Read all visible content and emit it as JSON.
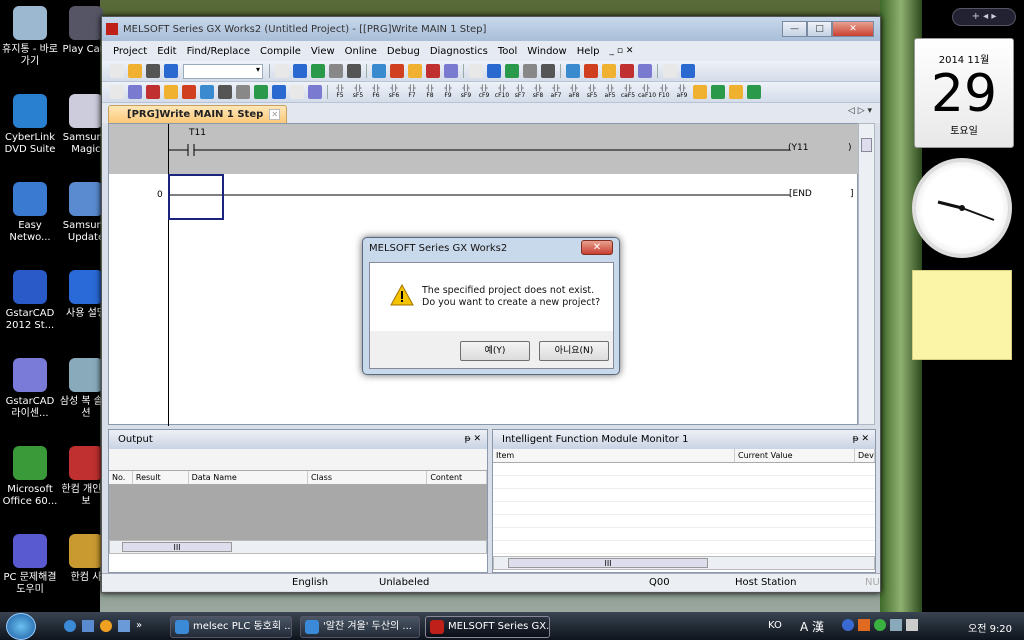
{
  "desktop": {
    "icons": [
      {
        "label": "휴지통 - 바로 가기",
        "color": "#9cb8d0"
      },
      {
        "label": "Play Cam",
        "color": "#556"
      },
      {
        "label": "CyberLink DVD Suite",
        "color": "#2a80d0"
      },
      {
        "label": "Samsung Magic",
        "color": "#ccd"
      },
      {
        "label": "Easy Netwo...",
        "color": "#3a7ad0"
      },
      {
        "label": "Samsung Update",
        "color": "#5a8ad0"
      },
      {
        "label": "GstarCAD 2012 St...",
        "color": "#2a5ac8"
      },
      {
        "label": "사용 설명",
        "color": "#2a6ad8"
      },
      {
        "label": "GstarCAD 라이센...",
        "color": "#7a7ad8"
      },
      {
        "label": "삼성 복 솔루션",
        "color": "#8ab"
      },
      {
        "label": "Microsoft Office 60...",
        "color": "#3a9a3a"
      },
      {
        "label": "한컴 개인정보",
        "color": "#c03030"
      },
      {
        "label": "PC 문제해결 도우미",
        "color": "#5a5ad0"
      },
      {
        "label": "한컴 사",
        "color": "#c89a30"
      }
    ]
  },
  "window": {
    "title": "MELSOFT Series GX Works2 (Untitled Project) - [[PRG]Write MAIN 1 Step]",
    "buttons": {
      "minimize": "—",
      "maximize": "□",
      "close": "✕"
    },
    "menu": [
      "Project",
      "Edit",
      "Find/Replace",
      "Compile",
      "View",
      "Online",
      "Debug",
      "Diagnostics",
      "Tool",
      "Window",
      "Help"
    ],
    "mdi_controls": "_ ▫ ✕",
    "fkeys": [
      "F5",
      "sF5",
      "F6",
      "sF6",
      "F7",
      "F8",
      "F9",
      "sF9",
      "cF9",
      "cF10",
      "sF7",
      "sF8",
      "aF7",
      "aF8",
      "sF5",
      "aF5",
      "caF5",
      "caF10",
      "F10",
      "aF9"
    ],
    "tab": {
      "label": "[PRG]Write MAIN 1 Step",
      "close": "✕",
      "nav": "◁ ▷ ▾"
    },
    "ladder": {
      "contact": "T11",
      "coil": "(Y11",
      "coil_end": ")",
      "step": "0",
      "end": "[END",
      "end_close": "]"
    },
    "output": {
      "title": "Output",
      "pin": "ᵽ",
      "close": "✕",
      "columns": [
        "No.",
        "Result",
        "Data Name",
        "Class",
        "Content"
      ],
      "scroll": "III"
    },
    "monitor": {
      "title": "Intelligent Function Module Monitor 1",
      "columns": [
        "Item",
        "Current Value",
        "Dev"
      ],
      "scroll": "III"
    },
    "status": {
      "language": "English",
      "label": "Unlabeled",
      "cpu": "Q00",
      "station": "Host Station",
      "num": "NU"
    }
  },
  "dialog": {
    "title": "MELSOFT Series GX Works2",
    "close": "✕",
    "line1": "The specified project does not exist.",
    "line2": "Do you want to create a new project?",
    "yes": "예(Y)",
    "no": "아니요(N)"
  },
  "gadgets": {
    "nav": "+  ◂ ▸",
    "year_month": "2014 11월",
    "day": "29",
    "weekday": "토요일"
  },
  "taskbar": {
    "tasks": [
      "melsec PLC 동호회 ...",
      "'알찬 겨울' 두산의 ...",
      "MELSOFT Series GX..."
    ],
    "tray_lang": "KO",
    "tray_ime": "A 漢",
    "time": "오전 9:20",
    "quicklaunch_more": "»"
  }
}
